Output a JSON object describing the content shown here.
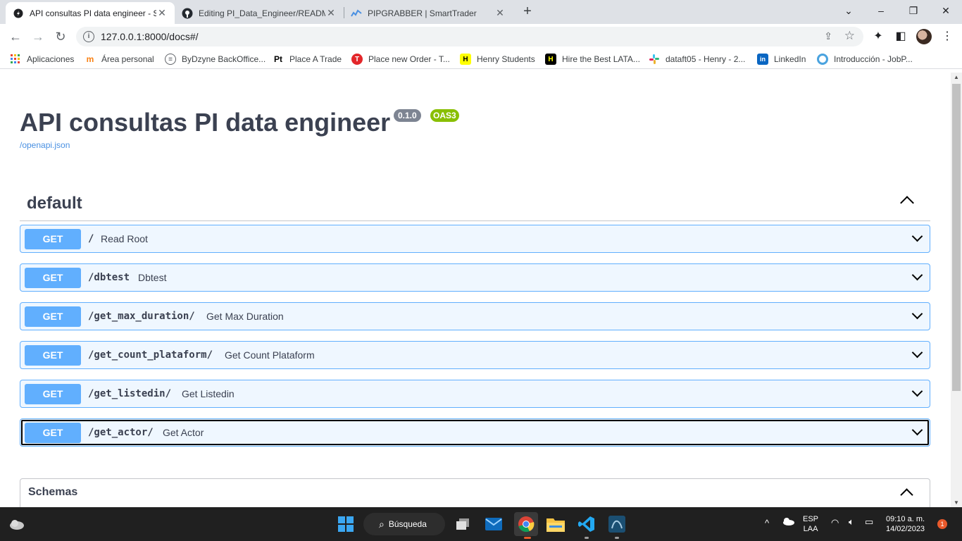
{
  "browser": {
    "tabs": [
      {
        "title": "API consultas PI data engineer - S",
        "active": true
      },
      {
        "title": "Editing PI_Data_Engineer/READM",
        "active": false
      },
      {
        "title": "PIPGRABBER | SmartTrader",
        "active": false
      }
    ],
    "address": "127.0.0.1:8000/docs#/",
    "bookmarks": [
      {
        "label": "Aplicaciones",
        "icon": "apps-grid-icon"
      },
      {
        "label": "Área personal",
        "icon": "m-logo-icon"
      },
      {
        "label": "ByDzyne BackOffice...",
        "icon": "globe-icon"
      },
      {
        "label": "Place A Trade",
        "icon": "pt-logo-icon"
      },
      {
        "label": "Place new Order - T...",
        "icon": "t-logo-icon"
      },
      {
        "label": "Henry Students",
        "icon": "henry-logo-icon"
      },
      {
        "label": "Hire the Best LATA...",
        "icon": "henry-logo-icon"
      },
      {
        "label": "dataft05 - Henry - 2...",
        "icon": "slack-icon"
      },
      {
        "label": "LinkedIn",
        "icon": "linkedin-icon"
      },
      {
        "label": "Introducción - JobP...",
        "icon": "circle-logo-icon"
      }
    ]
  },
  "swagger": {
    "title": "API consultas PI data engineer",
    "version": "0.1.0",
    "oas": "OAS3",
    "spec_link": "/openapi.json",
    "section": "default",
    "operations": [
      {
        "method": "GET",
        "path": "/",
        "summary": "Read Root"
      },
      {
        "method": "GET",
        "path": "/dbtest",
        "summary": "Dbtest"
      },
      {
        "method": "GET",
        "path": "/get_max_duration/",
        "summary": "Get Max Duration"
      },
      {
        "method": "GET",
        "path": "/get_count_plataform/",
        "summary": "Get Count Plataform"
      },
      {
        "method": "GET",
        "path": "/get_listedin/",
        "summary": "Get Listedin"
      },
      {
        "method": "GET",
        "path": "/get_actor/",
        "summary": "Get Actor"
      }
    ],
    "schemas_label": "Schemas"
  },
  "taskbar": {
    "search": "Búsqueda",
    "lang": "ESP",
    "layout": "LAA",
    "time": "09:10 a. m.",
    "date": "14/02/2023",
    "notifications": "1"
  },
  "colors": {
    "get_blue": "#61affe",
    "oas_green": "#89bf04",
    "version_gray": "#7d8492",
    "title": "#3b4151"
  }
}
